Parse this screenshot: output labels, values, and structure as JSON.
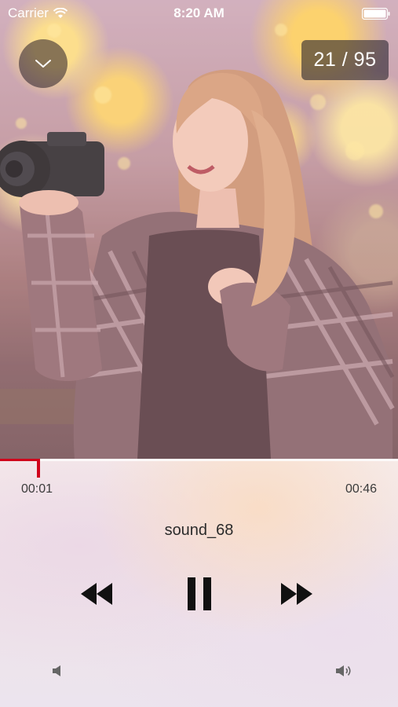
{
  "status_bar": {
    "carrier": "Carrier",
    "time": "8:20 AM"
  },
  "viewer": {
    "counter": "21 / 95",
    "dismiss_icon": "chevron-down-icon"
  },
  "player": {
    "progress_fraction": 0.0217,
    "elapsed": "00:01",
    "duration": "00:46",
    "track_title": "sound_68",
    "is_playing": true,
    "accent_color": "#d0021b"
  },
  "icons": {
    "rewind": "rewind-icon",
    "pause": "pause-icon",
    "forward": "fast-forward-icon",
    "volume_min": "volume-low-icon",
    "volume_max": "volume-high-icon"
  }
}
